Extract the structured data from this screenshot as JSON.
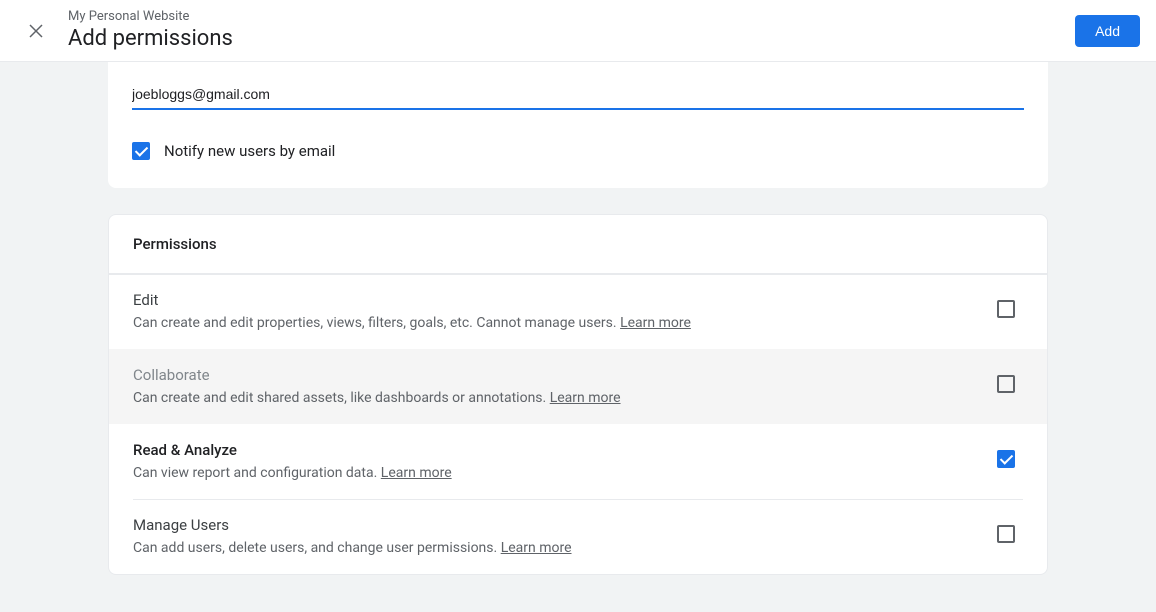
{
  "header": {
    "subtitle": "My Personal Website",
    "title": "Add permissions",
    "add_label": "Add"
  },
  "email_card": {
    "email_value": "joebloggs@gmail.com",
    "notify_label": "Notify new users by email"
  },
  "permissions": {
    "section_title": "Permissions",
    "learn_more": "Learn more",
    "rows": [
      {
        "title": "Edit",
        "desc": "Can create and edit properties, views, filters, goals, etc. Cannot manage users."
      },
      {
        "title": "Collaborate",
        "desc": "Can create and edit shared assets, like dashboards or annotations."
      },
      {
        "title": "Read & Analyze",
        "desc": "Can view report and configuration data."
      },
      {
        "title": "Manage Users",
        "desc": "Can add users, delete users, and change user permissions."
      }
    ]
  }
}
